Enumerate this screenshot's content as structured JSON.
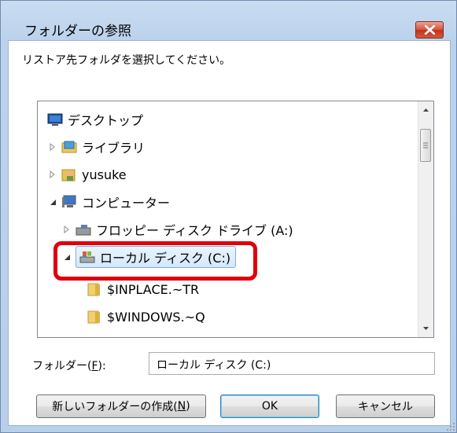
{
  "dialog": {
    "title": "フォルダーの参照",
    "instruction": "リストア先フォルダを選択してください。"
  },
  "tree": {
    "items": [
      {
        "label": "デスクトップ",
        "icon": "desktop-icon"
      },
      {
        "label": "ライブラリ",
        "icon": "library-icon"
      },
      {
        "label": "yusuke",
        "icon": "user-folder-icon"
      },
      {
        "label": "コンピューター",
        "icon": "computer-icon"
      },
      {
        "label": "フロッピー ディスク ドライブ (A:)",
        "icon": "floppy-drive-icon"
      },
      {
        "label": "ローカル ディスク (C:)",
        "icon": "local-disk-icon",
        "selected": true
      },
      {
        "label": "$INPLACE.~TR",
        "icon": "folder-icon"
      },
      {
        "label": "$WINDOWS.~Q",
        "icon": "folder-icon"
      }
    ]
  },
  "folder_field": {
    "label": "フォルダー(F):",
    "label_main": "フォルダー(",
    "label_key": "F",
    "label_end": "):",
    "value": "ローカル ディスク (C:)"
  },
  "buttons": {
    "new_folder_main": "新しいフォルダーの作成(",
    "new_folder_key": "N",
    "new_folder_end": ")",
    "ok": "OK",
    "cancel": "キャンセル"
  },
  "colors": {
    "highlight": "#e0000d",
    "selection": "#d3e8fb",
    "close_button": "#c2311c"
  }
}
